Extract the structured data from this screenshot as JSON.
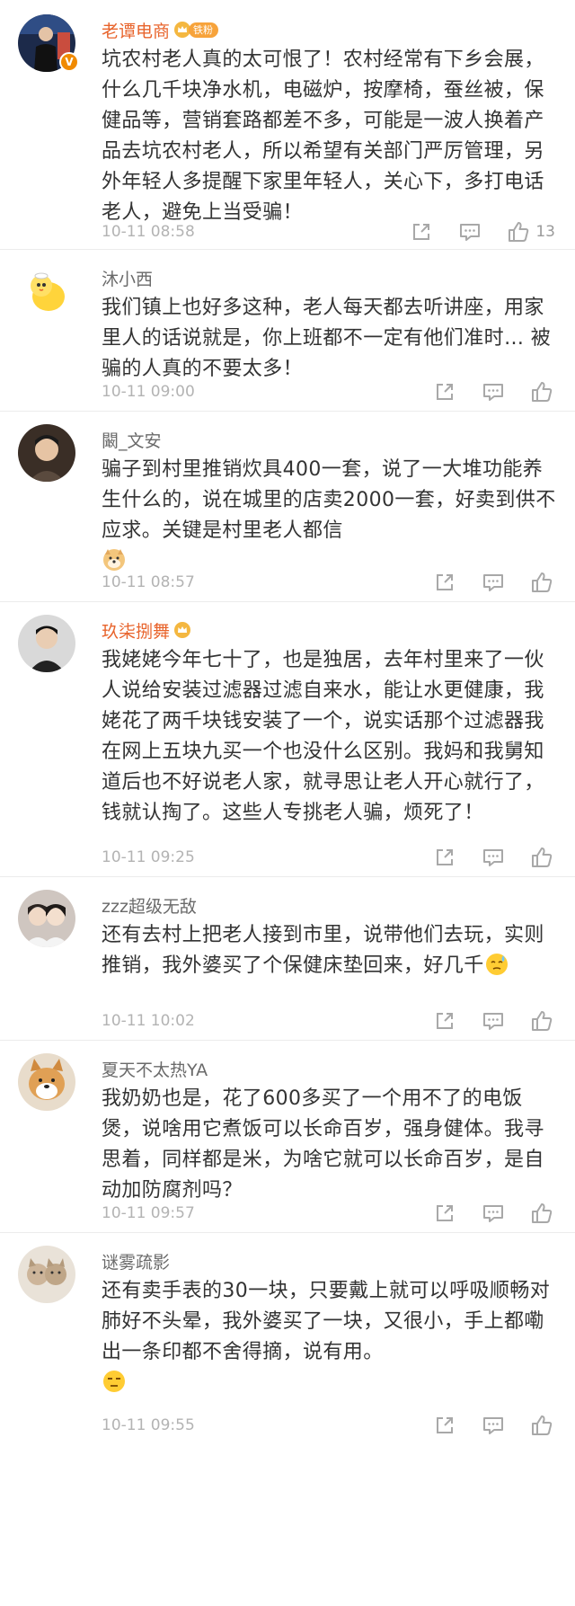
{
  "colors": {
    "background": "#ffffff",
    "text": "#333333",
    "username": "#6a6a6a",
    "vip_username": "#e8642c",
    "meta": "#b3b3b3",
    "icon": "#a8a8a8",
    "verified_badge": "#f08a00",
    "divider": "#ececec"
  },
  "comments": [
    {
      "username": "老谭电商",
      "fan_tag": "铁粉",
      "verified": true,
      "text": "坑农村老人真的太可恨了！农村经常有下乡会展，什么几千块净水机，电磁炉，按摩椅，蚕丝被，保健品等，营销套路都差不多，可能是一波人换着产品去坑农村老人，所以希望有关部门严厉管理，另外年轻人多提醒下家里年轻人，关心下，多打电话老人，避免上当受骗！",
      "time": "10-11 08:58",
      "likes": "13"
    },
    {
      "username": "沐小西",
      "text": "我们镇上也好多这种，老人每天都去听讲座，用家里人的话说就是，你上班都不一定有他们准时… 被骗的人真的不要太多！",
      "time": "10-11 09:00"
    },
    {
      "username": "闞_文安",
      "text": "骗子到村里推销炊具400一套，说了一大堆功能养生什么的，说在城里的店卖2000一套，好卖到供不应求。关键是村里老人都信",
      "emoji": "doge-emoji",
      "time": "10-11 08:57"
    },
    {
      "username": "玖柒捌舞",
      "text": "我姥姥今年七十了，也是独居，去年村里来了一伙人说给安装过滤器过滤自来水，能让水更健康，我姥花了两千块钱安装了一个，说实话那个过滤器我在网上五块九买一个也没什么区别。我妈和我舅知道后也不好说老人家，就寻思让老人开心就行了，钱就认掏了。这些人专挑老人骗，烦死了！",
      "time": "10-11 09:25"
    },
    {
      "username": "zzz超级无敌",
      "text": "还有去村上把老人接到市里，说带他们去玩，实则推销，我外婆买了个保健床垫回来，好几千",
      "emoji": "sweat-emoji",
      "time": "10-11 10:02"
    },
    {
      "username": "夏天不太热YA",
      "text": "我奶奶也是，花了600多买了一个用不了的电饭煲，说啥用它煮饭可以长命百岁，强身健体。我寻思着，同样都是米，为啥它就可以长命百岁，是自动加防腐剂吗？",
      "time": "10-11 09:57"
    },
    {
      "username": "谜雾疏影",
      "text": "还有卖手表的30一块，只要戴上就可以呼吸顺畅对肺好不头晕，我外婆买了一块，又很小，手上都嘞出一条印都不舍得摘，说有用。",
      "emoji": "unamused-emoji",
      "time": "10-11 09:55"
    }
  ]
}
